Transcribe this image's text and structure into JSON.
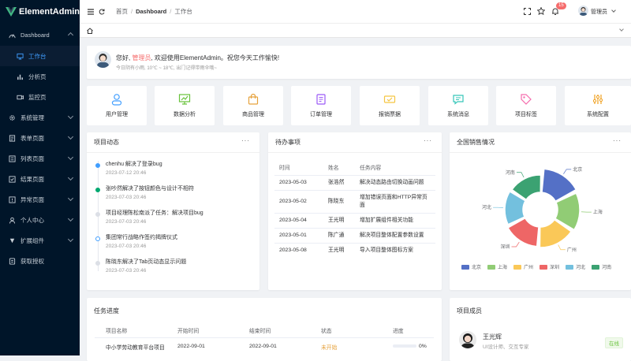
{
  "app": {
    "name": "ElementAdmin"
  },
  "sidebar": {
    "items": [
      {
        "label": "Dashboard",
        "expanded": true
      },
      {
        "label": "工作台",
        "active": true
      },
      {
        "label": "分析页"
      },
      {
        "label": "监控页"
      },
      {
        "label": "系统管理"
      },
      {
        "label": "表单页面"
      },
      {
        "label": "列表页面"
      },
      {
        "label": "结果页面"
      },
      {
        "label": "异常页面"
      },
      {
        "label": "个人中心"
      },
      {
        "label": "扩展组件"
      },
      {
        "label": "获取授权"
      }
    ]
  },
  "header": {
    "breadcrumb": [
      "首页",
      "Dashboard",
      "工作台"
    ],
    "notification_count": "15",
    "user_name": "管理员"
  },
  "welcome": {
    "greeting_prefix": "您好, ",
    "user": "管理员",
    "greeting_suffix": ", 欢迎使用ElementAdmin。祝您今天工作愉快!",
    "weather": "今日阴有小雨, 10℃ ~ 18℃, 出门记得带雨伞哦~"
  },
  "quick_links": [
    {
      "label": "用户管理",
      "icon": "user-icon",
      "color": "#409eff"
    },
    {
      "label": "数据分析",
      "icon": "chart-board-icon",
      "color": "#67c23a"
    },
    {
      "label": "商品管理",
      "icon": "shopping-bag-icon",
      "color": "#e6a23c"
    },
    {
      "label": "订单管理",
      "icon": "document-icon",
      "color": "#9b59f6"
    },
    {
      "label": "报销票据",
      "icon": "ticket-icon",
      "color": "#f5c542"
    },
    {
      "label": "系统消息",
      "icon": "message-icon",
      "color": "#36c6b9"
    },
    {
      "label": "项目标签",
      "icon": "tag-icon",
      "color": "#f56cad"
    },
    {
      "label": "系统配置",
      "icon": "settings-sliders-icon",
      "color": "#f0a020"
    }
  ],
  "activity": {
    "title": "项目动态",
    "items": [
      {
        "text": "chenhu 解决了登录bug",
        "time": "2023-07-12 20:46",
        "dot": "#409eff"
      },
      {
        "text": "张吵然解决了按钮颜色与设计不相符",
        "time": "2023-07-03 20:46",
        "dot": "#00a870"
      },
      {
        "text": "项目经理陈松南派了任务：解决项目bug",
        "time": "2023-07-03 20:46",
        "dot": "#dcdfe6"
      },
      {
        "text": "集团常行战略作签约揭牌仪式",
        "time": "2023-07-03 20:46",
        "dot": "#409eff"
      },
      {
        "text": "陈晓东解决了Tab页动态显示问题",
        "time": "2023-07-03 20:46",
        "dot": "#dcdfe6"
      }
    ]
  },
  "todo": {
    "title": "待办事项",
    "headers": [
      "时间",
      "姓名",
      "任务内容"
    ],
    "rows": [
      [
        "2023-05-03",
        "张浩然",
        "解决动态路由切换动画问题"
      ],
      [
        "2023-05-02",
        "陈晓东",
        "增加错误页面和HTTP异常页面"
      ],
      [
        "2023-05-04",
        "王光明",
        "增加扩展组件相关功能"
      ],
      [
        "2023-05-01",
        "陈广通",
        "解决项目整体配置参数设置"
      ],
      [
        "2023-05-08",
        "王光明",
        "导入项目整体图标方案"
      ]
    ]
  },
  "sales": {
    "title": "全国销售情况",
    "slice_labels": [
      "北京",
      "上海",
      "广州",
      "深圳",
      "河北",
      "河南"
    ],
    "legend": [
      "北京",
      "上海",
      "广州",
      "深圳",
      "河北",
      "河南"
    ],
    "colors": [
      "#5470c6",
      "#91cc75",
      "#fac858",
      "#ee6666",
      "#73c0de",
      "#3ba272"
    ]
  },
  "tasks": {
    "title": "任务进度",
    "headers": [
      "项目名称",
      "开始时间",
      "结束时间",
      "状态",
      "进度"
    ],
    "rows": [
      {
        "name": "中小学劳动教育平台项目",
        "start": "2022-09-01",
        "end": "2022-09-01",
        "status": "未开始",
        "progress": "0%"
      }
    ]
  },
  "members": {
    "title": "项目成员",
    "items": [
      {
        "name": "王光辉",
        "role": "UI设计师、交互专家",
        "status": "在线"
      }
    ]
  },
  "tab_home": "home-icon"
}
